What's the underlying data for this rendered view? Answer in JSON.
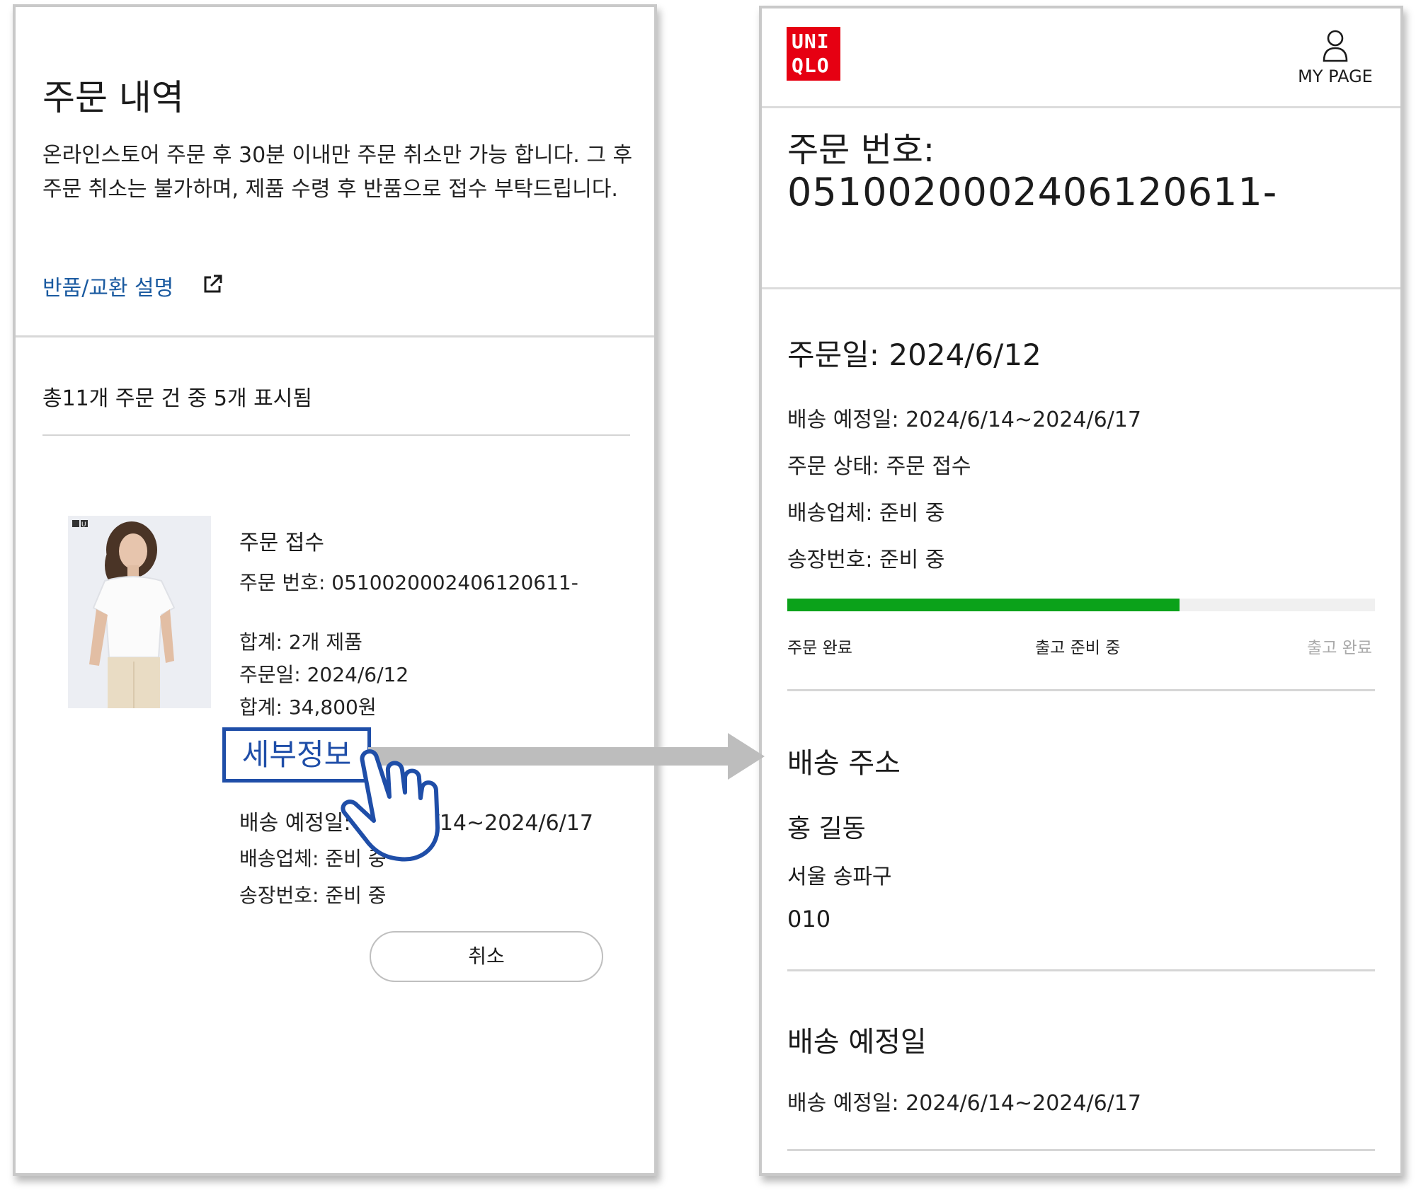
{
  "left": {
    "title": "주문 내역",
    "notice": "온라인스토어 주문 후 30분 이내만 주문 취소만 가능 합니다. 그 후 주문 취소는 불가하며, 제품 수령 후 반품으로 접수 부탁드립니다.",
    "return_link": "반품/교환 설명",
    "count_text": "총11개 주문 건 중 5개 표시됨",
    "order": {
      "status": "주문 접수",
      "order_number": "주문 번호: 0510020002406120611-",
      "qty": "합계: 2개 제품",
      "date": "주문일: 2024/6/12",
      "total": "합계: 34,800원",
      "details_button": "세부정보",
      "ship_date": "배송 예정일: 2024/6/14~2024/6/17",
      "carrier": "배송업체: 준비 중",
      "tracking": "송장번호: 준비 중",
      "cancel_button": "취소",
      "image_badge": "U"
    }
  },
  "right": {
    "brand": {
      "line1": "UNI",
      "line2": "QLO",
      "color": "#e60012"
    },
    "my_page": "MY PAGE",
    "order_number_label": "주문 번호:",
    "order_number_value": "0510020002406120611-",
    "order_date": "주문일: 2024/6/12",
    "ship_date": "배송 예정일: 2024/6/14~2024/6/17",
    "status": "주문 상태: 주문 접수",
    "carrier": "배송업체: 준비 중",
    "tracking": "송장번호: 준비 중",
    "progress": {
      "fraction": 0.667,
      "color": "#0ba21a"
    },
    "steps": [
      "주문 완료",
      "출고 준비 중",
      "출고 완료"
    ],
    "address_title": "배송 주소",
    "recipient_name": "홍 길동",
    "address_city": "서울 송파구",
    "phone": "010",
    "eta_title": "배송 예정일",
    "eta": "배송 예정일: 2024/6/14~2024/6/17"
  },
  "icons": {
    "external_link": "external-link-icon",
    "user": "user-icon",
    "pointer": "pointing-hand-icon",
    "arrow": "right-arrow"
  }
}
